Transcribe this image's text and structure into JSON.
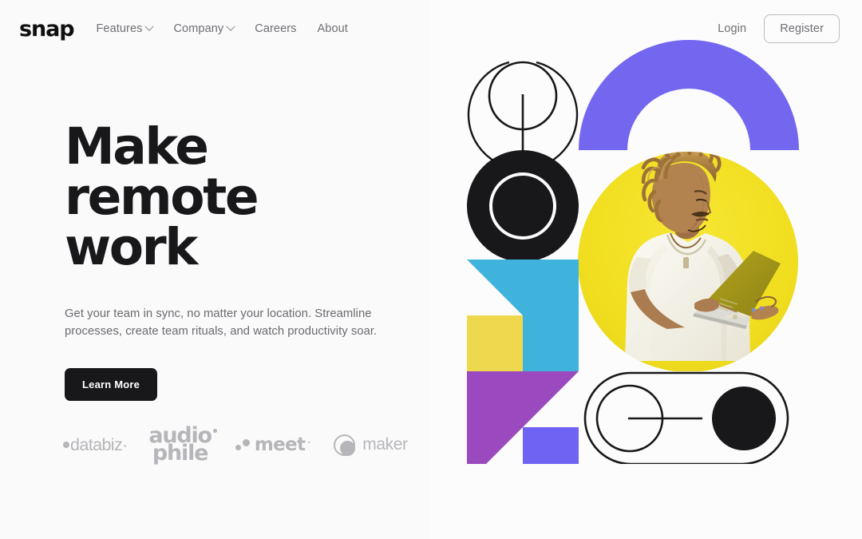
{
  "brand": {
    "name": "snap"
  },
  "nav": {
    "links": [
      {
        "label": "Features",
        "has_dropdown": true,
        "icon": "chevron-down-icon"
      },
      {
        "label": "Company",
        "has_dropdown": true,
        "icon": "chevron-down-icon"
      },
      {
        "label": "Careers",
        "has_dropdown": false
      },
      {
        "label": "About",
        "has_dropdown": false
      }
    ],
    "login_label": "Login",
    "register_label": "Register"
  },
  "hero": {
    "headline_line1": "Make remote",
    "headline_line2": "work",
    "subcopy": "Get your team in sync, no matter your location. Streamline processes, create team rituals, and watch productivity soar.",
    "cta_label": "Learn More"
  },
  "client_logos": [
    {
      "name": "databiz",
      "label": "databiz",
      "mark": "dot-mark-icon"
    },
    {
      "name": "audiophile",
      "label_top": "audio",
      "label_bottom": "phile",
      "mark": "dot-accent-icon"
    },
    {
      "name": "meet",
      "label": "meet",
      "mark": "two-dots-icon"
    },
    {
      "name": "maker",
      "label": "maker",
      "mark": "ring-circle-icon"
    }
  ],
  "artwork": {
    "description": "Abstract geometric collage with photo of a man working on a laptop",
    "colors": {
      "periwinkle": "#7367f0",
      "indigo": "#6f63f4",
      "yellow": "#eed94e",
      "photo_yellow": "#f2e022",
      "sky_blue": "#40b3dd",
      "purple": "#9b49bf",
      "black": "#18181b",
      "background": "#fcfcfc"
    },
    "shapes": [
      "outer-arc-ring",
      "inner-circle-outline",
      "vertical-stem",
      "black-donut",
      "purple-arch",
      "yellow-photo-circle",
      "blue-square",
      "blue-triangle",
      "yellow-square",
      "purple-triangle",
      "indigo-rectangle",
      "stadium-outline",
      "small-circle-outline",
      "connector-line",
      "black-dot-circle"
    ]
  },
  "theme": {
    "page_background": "#fafafa",
    "text_primary": "#18181b",
    "text_muted": "#6b6b71",
    "button_bg": "#18181b",
    "button_text": "#ffffff"
  }
}
